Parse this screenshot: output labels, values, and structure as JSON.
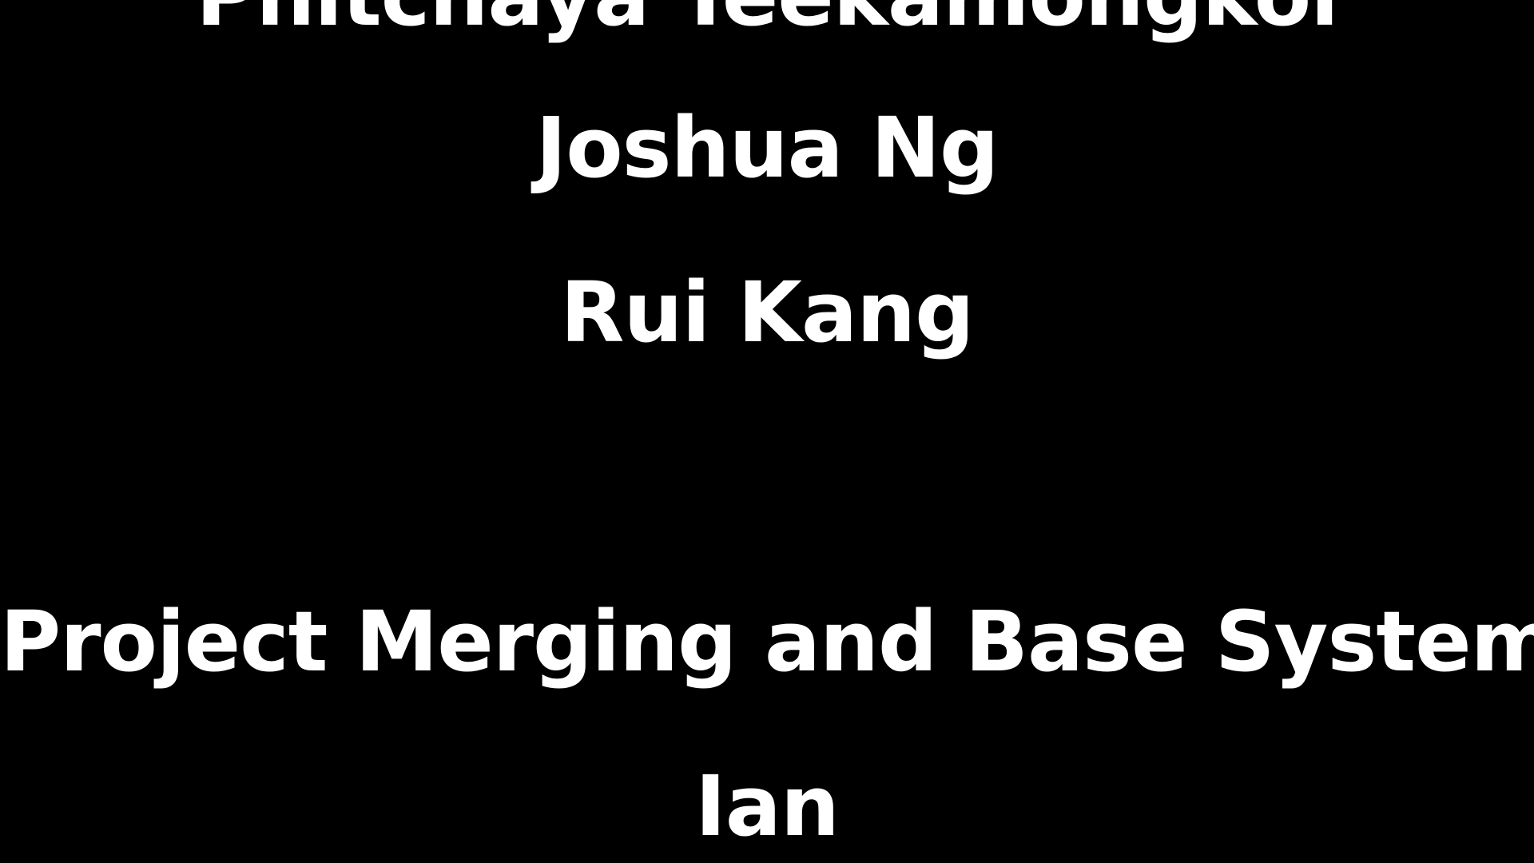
{
  "credits": {
    "lines": [
      "Phitchaya Teekamongkol",
      "Joshua Ng",
      "Rui Kang",
      "Project Merging and Base Systems",
      "Ian"
    ]
  }
}
